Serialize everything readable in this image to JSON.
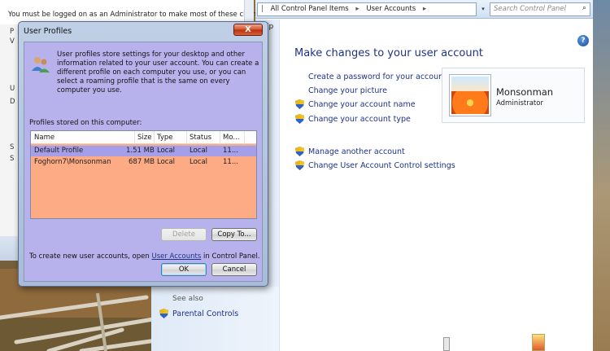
{
  "background_window": {
    "notice": "You must be logged on as an Administrator to make most of these changes.",
    "side_letters": [
      "P",
      "V",
      "U",
      "D",
      "S",
      "S"
    ]
  },
  "control_panel": {
    "breadcrumbs": [
      "All Control Panel Items",
      "User Accounts"
    ],
    "search_placeholder": "Search Control Panel",
    "partial_left_text": "lp",
    "heading": "Make changes to your user account",
    "links": [
      {
        "label": "Create a password for your account",
        "shield": false
      },
      {
        "label": "Change your picture",
        "shield": false
      },
      {
        "label": "Change your account name",
        "shield": true
      },
      {
        "label": "Change your account type",
        "shield": true
      },
      {
        "label": "Manage another account",
        "shield": true
      },
      {
        "label": "Change User Account Control settings",
        "shield": true
      }
    ],
    "account": {
      "name": "Monsonman",
      "role": "Administrator"
    },
    "see_also": "See also",
    "parental_controls": "Parental Controls",
    "help_glyph": "?"
  },
  "dialog": {
    "title": "User Profiles",
    "close_glyph": "X",
    "description": "User profiles store settings for your desktop and other information related to your user account. You can create a different profile on each computer you use, or you can select a roaming profile that is the same on every computer you use.",
    "stored_label": "Profiles stored on this computer:",
    "columns": [
      "Name",
      "Size",
      "Type",
      "Status",
      "Mo..."
    ],
    "profiles": [
      {
        "name": "Default Profile",
        "size": "1.51 MB",
        "type": "Local",
        "status": "Local",
        "modified": "11...",
        "selected": true
      },
      {
        "name": "Foghorn7\\Monsonman",
        "size": "687 MB",
        "type": "Local",
        "status": "Local",
        "modified": "11...",
        "selected": false
      }
    ],
    "delete_label": "Delete",
    "copy_label": "Copy To...",
    "create_prefix": "To create new user accounts, open",
    "create_link": "User Accounts",
    "create_suffix": "in Control Panel.",
    "ok_label": "OK",
    "cancel_label": "Cancel"
  },
  "colors": {
    "link": "#1e3287",
    "dialog_body": "#b8b2ec",
    "list_bg": "#fdab84",
    "selected_row": "#a59ee8"
  }
}
